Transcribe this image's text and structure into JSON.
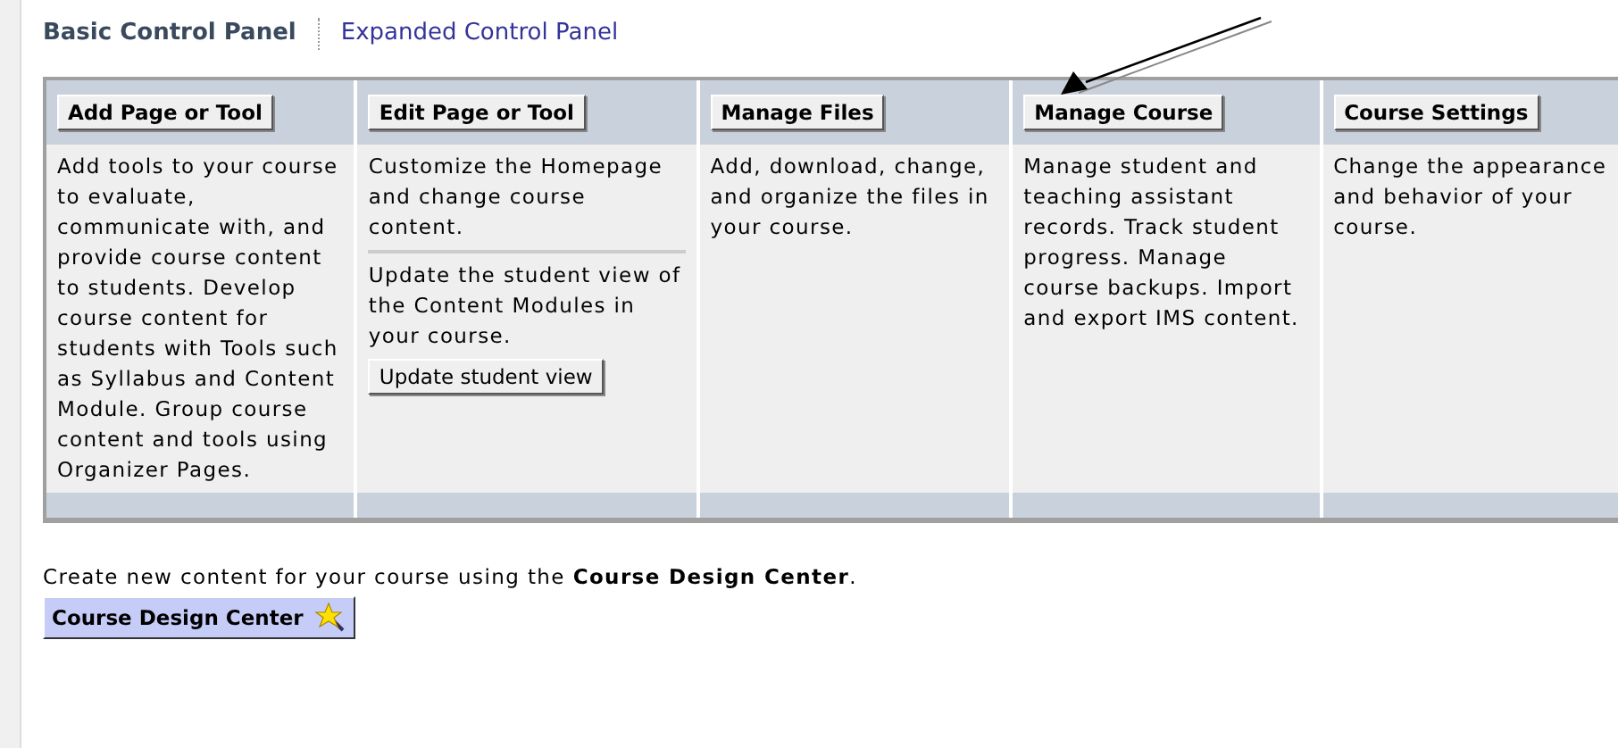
{
  "tabs": [
    {
      "label": "Basic Control Panel",
      "selected": true
    },
    {
      "label": "Expanded Control Panel",
      "selected": false
    }
  ],
  "panel": {
    "columns": [
      {
        "button": "Add Page or Tool",
        "sections": [
          {
            "text": "Add tools to your course to evaluate, communicate with, and provide course content to students. Develop course content for students with Tools such as Syllabus and Content Module. Group course content and tools using Organizer Pages."
          }
        ]
      },
      {
        "button": "Edit Page or Tool",
        "sections": [
          {
            "text": "Customize the Homepage and change course content."
          },
          {
            "text": "Update the student view of the Content Modules in your course.",
            "button": "Update student view"
          }
        ]
      },
      {
        "button": "Manage Files",
        "sections": [
          {
            "text": "Add, download, change, and organize the files in your course."
          }
        ]
      },
      {
        "button": "Manage Course",
        "sections": [
          {
            "text": "Manage student and teaching assistant records. Track student progress. Manage course backups. Import and export IMS content."
          }
        ]
      },
      {
        "button": "Course Settings",
        "sections": [
          {
            "text": "Change the appearance and behavior of your course."
          }
        ]
      }
    ]
  },
  "design_center": {
    "text": "Create new content for your course using the **Course Design Center**.",
    "button": "Course Design Center"
  }
}
